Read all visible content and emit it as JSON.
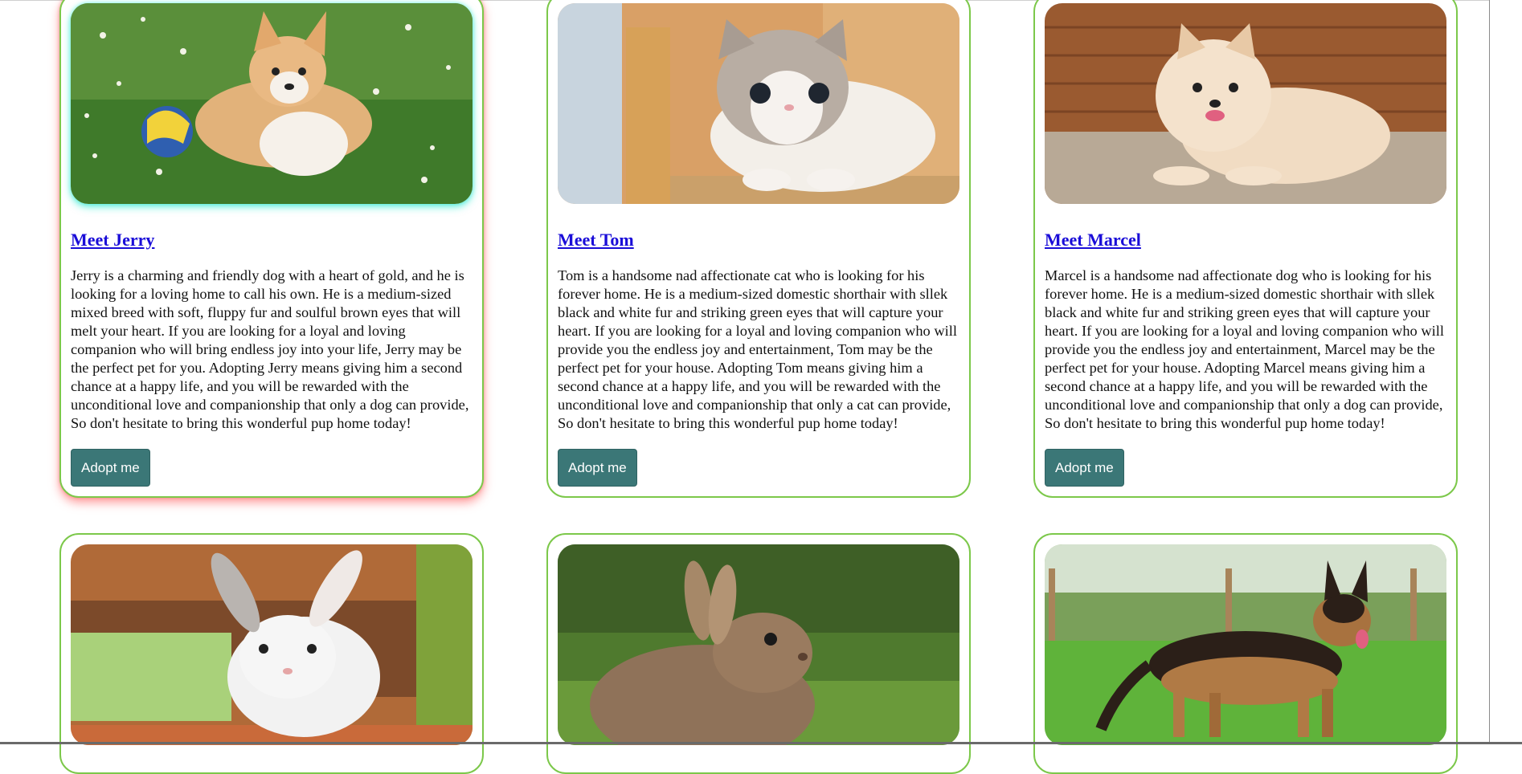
{
  "cards": [
    {
      "title": "Meet Jerry",
      "description": "Jerry is a charming and friendly dog with a heart of gold, and he is looking for a loving home to call his own. He is a medium-sized mixed breed with soft, fluppy fur and soulful brown eyes that will melt your heart. If you are looking for a loyal and loving companion who will bring endless joy into your life, Jerry may be the perfect pet for you. Adopting Jerry means giving him a second chance at a happy life, and you will be rewarded with the unconditional love and companionship that only a dog can provide, So don't hesitate to bring this wonderful pup home today!",
      "button": "Adopt me",
      "photo": "corgi-puppy-photo"
    },
    {
      "title": "Meet Tom",
      "description": "Tom is a handsome nad affectionate cat who is looking for his forever home. He is a medium-sized domestic shorthair with sllek black and white fur and striking green eyes that will capture your heart. If you are looking for a loyal and loving companion who will provide you the endless joy and entertainment, Tom may be the perfect pet for your house. Adopting Tom means giving him a second chance at a happy life, and you will be rewarded with the unconditional love and companionship that only a cat can provide, So don't hesitate to bring this wonderful pup home today!",
      "button": "Adopt me",
      "photo": "kitten-photo"
    },
    {
      "title": "Meet Marcel",
      "description": "Marcel is a handsome nad affectionate dog who is looking for his forever home. He is a medium-sized domestic shorthair with sllek black and white fur and striking green eyes that will capture your heart. If you are looking for a loyal and loving companion who will provide you the endless joy and entertainment, Marcel may be the perfect pet for your house. Adopting Marcel means giving him a second chance at a happy life, and you will be rewarded with the unconditional love and companionship that only a dog can provide, So don't hesitate to bring this wonderful pup home today!",
      "button": "Adopt me",
      "photo": "pomeranian-photo"
    },
    {
      "photo": "white-rabbit-photo"
    },
    {
      "photo": "brown-rabbit-photo"
    },
    {
      "photo": "german-shepherd-photo"
    }
  ],
  "colors": {
    "card_border": "#7cc84a",
    "link": "#1a0dd8",
    "button_bg": "#3b7777"
  }
}
